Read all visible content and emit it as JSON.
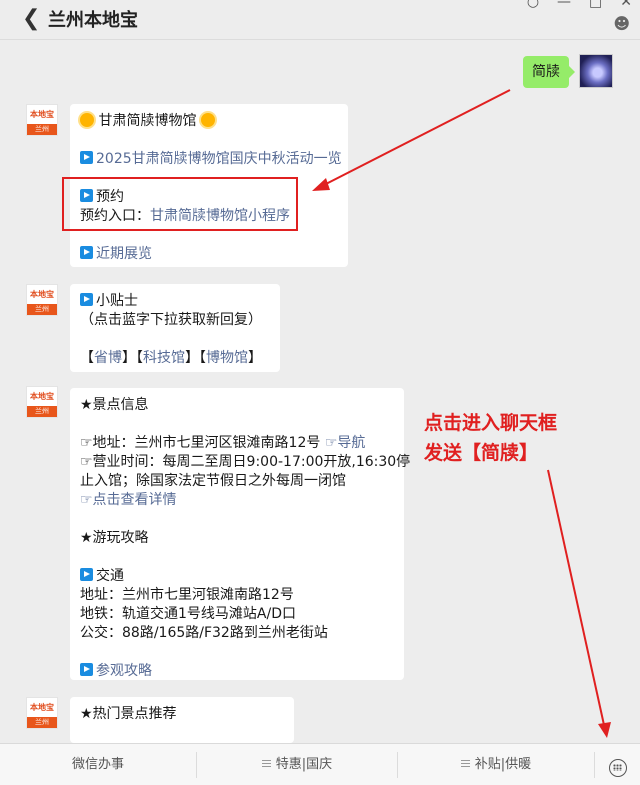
{
  "header": {
    "title": "兰州本地宝"
  },
  "user_message": {
    "text": "简牍"
  },
  "bot_avatar": {
    "logo_text": "本地宝",
    "city": "兰州"
  },
  "messages": [
    {
      "title": "甘肃简牍博物馆",
      "link1": "2025甘肃简牍博物馆国庆中秋活动一览",
      "reserve_heading": "预约",
      "reserve_prefix": "预约入口：",
      "reserve_link": "甘肃简牍博物馆小程序",
      "link3": "近期展览"
    },
    {
      "heading": "小贴士",
      "note": "（点击蓝字下拉获取新回复）",
      "links": [
        "省博",
        "科技馆",
        "博物馆"
      ]
    },
    {
      "info_heading": "★景点信息",
      "address_prefix": "☞地址：兰州市七里河区银滩南路12号 ",
      "nav_link": "☞导航",
      "hours_line1": "☞营业时间：每周二至周日9:00-17:00开放,16:30停",
      "hours_line2": "止入馆；除国家法定节假日之外每周一闭馆",
      "details_link": "☞点击查看详情",
      "guide_heading": "★游玩攻略",
      "transport_heading": "交通",
      "address_line": "地址：兰州市七里河银滩南路12号",
      "metro_line": "地铁：轨道交通1号线马滩站A/D口",
      "bus_line": "公交：88路/165路/F32路到兰州老街站",
      "visit_link": "参观攻略"
    },
    {
      "heading": "★热门景点推荐"
    }
  ],
  "annotation": {
    "line1": "点击进入聊天框",
    "line2": "发送【简牍】"
  },
  "bottom_menu": [
    {
      "label": "微信办事"
    },
    {
      "label": "特惠|国庆"
    },
    {
      "label": "补贴|供暖"
    }
  ],
  "colors": {
    "link": "#576b95",
    "annotation_red": "#e02020",
    "user_bubble": "#95ec69",
    "play_icon": "#1a8ce0"
  }
}
